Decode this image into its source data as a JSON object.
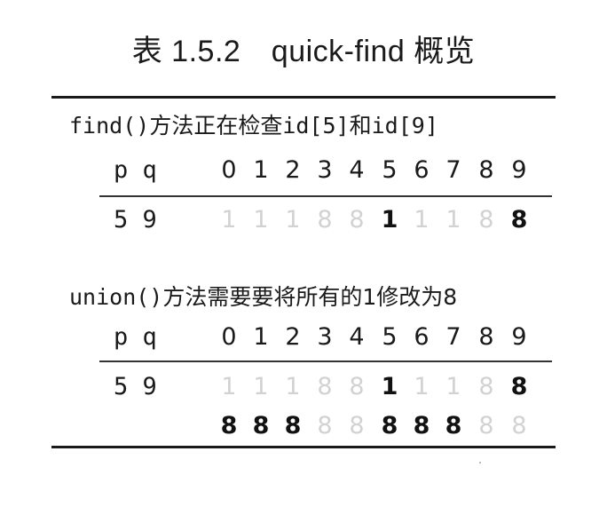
{
  "title": "表 1.5.2　quick-find 概览",
  "find_section": {
    "caption_code_1": "find()",
    "caption_text_1": "方法正在检查",
    "caption_code_2": "id[5]",
    "caption_text_2": "和",
    "caption_code_3": "id[9]",
    "header_pq": "p q",
    "headers": [
      "0",
      "1",
      "2",
      "3",
      "4",
      "5",
      "6",
      "7",
      "8",
      "9"
    ],
    "row_pq": "5 9",
    "row_values": [
      {
        "v": "1",
        "emph": false
      },
      {
        "v": "1",
        "emph": false
      },
      {
        "v": "1",
        "emph": false
      },
      {
        "v": "8",
        "emph": false
      },
      {
        "v": "8",
        "emph": false
      },
      {
        "v": "1",
        "emph": true
      },
      {
        "v": "1",
        "emph": false
      },
      {
        "v": "1",
        "emph": false
      },
      {
        "v": "8",
        "emph": false
      },
      {
        "v": "8",
        "emph": true
      }
    ]
  },
  "union_section": {
    "caption_code": "union()",
    "caption_text": "方法需要要将所有的1修改为8",
    "header_pq": "p q",
    "headers": [
      "0",
      "1",
      "2",
      "3",
      "4",
      "5",
      "6",
      "7",
      "8",
      "9"
    ],
    "row_pq": "5 9",
    "row_values_before": [
      {
        "v": "1",
        "emph": false
      },
      {
        "v": "1",
        "emph": false
      },
      {
        "v": "1",
        "emph": false
      },
      {
        "v": "8",
        "emph": false
      },
      {
        "v": "8",
        "emph": false
      },
      {
        "v": "1",
        "emph": true
      },
      {
        "v": "1",
        "emph": false
      },
      {
        "v": "1",
        "emph": false
      },
      {
        "v": "8",
        "emph": false
      },
      {
        "v": "8",
        "emph": true
      }
    ],
    "row_values_after": [
      {
        "v": "8",
        "emph": true
      },
      {
        "v": "8",
        "emph": true
      },
      {
        "v": "8",
        "emph": true
      },
      {
        "v": "8",
        "emph": false
      },
      {
        "v": "8",
        "emph": false
      },
      {
        "v": "8",
        "emph": true
      },
      {
        "v": "8",
        "emph": true
      },
      {
        "v": "8",
        "emph": true
      },
      {
        "v": "8",
        "emph": false
      },
      {
        "v": "8",
        "emph": false
      }
    ]
  },
  "colors": {
    "text": "#1a1a1a",
    "faded": "#d2d2d2"
  }
}
